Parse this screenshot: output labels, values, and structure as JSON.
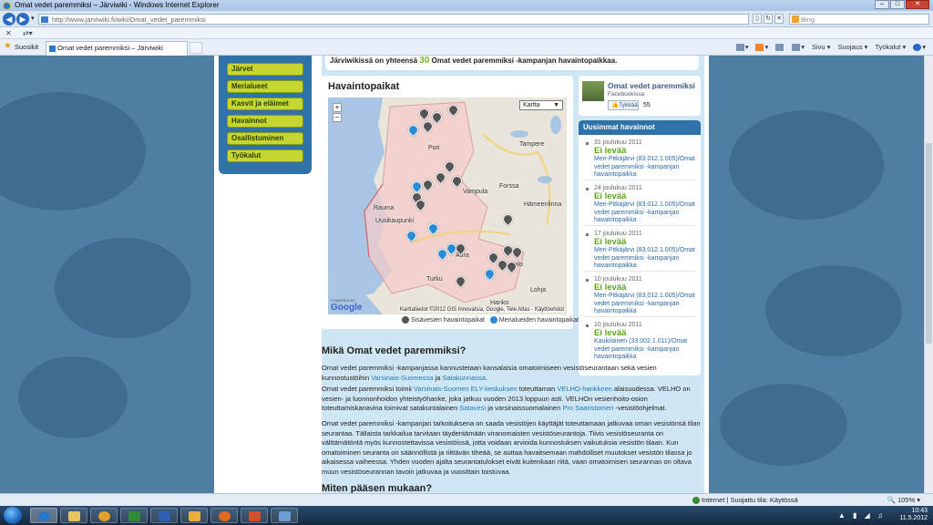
{
  "browser": {
    "title": "Omat vedet paremmiksi – Järviwiki - Windows Internet Explorer",
    "url": "http://www.jarviwiki.fi/wiki/Omat_vedet_paremmiksi",
    "search_placeholder": "Bing",
    "tab_label": "Omat vedet paremmiksi – Järviwiki",
    "favorites_label": "Suosikit",
    "cmd_page": "Sivu",
    "cmd_safety": "Suojaus",
    "cmd_tools": "Työkalut"
  },
  "sidebar": {
    "items": [
      "Järvet",
      "Merialueet",
      "Kasvit ja eläimet",
      "Havainnot",
      "Osallistuminen",
      "Työkalut"
    ]
  },
  "intro": {
    "prefix": "Järviwikissä on yhteensä",
    "count": "30",
    "suffix": "Omat vedet paremmiksi -kampanjan havaintopaikkaa."
  },
  "map": {
    "title": "Havaintopaikat",
    "type_select": "Kartta",
    "zoom_in": "+",
    "zoom_out": "−",
    "copyright": "Karttatiedot ©2012 GIS Innovatsia, Google, Tele Atlas - Käyttöehdot",
    "google": "Google",
    "powered": "POWERED BY",
    "places": [
      "Pori",
      "Tampere",
      "Rauma",
      "Vampula",
      "Uusikaupunki",
      "Hämeenlinna",
      "Aura",
      "Turku",
      "Salo",
      "Lohja",
      "Hanko",
      "Forssa"
    ],
    "legend_inland": "Sisävesien havaintopaikat",
    "legend_sea": "Merialueiden havaintopaikat",
    "inland_color": "#555555",
    "sea_color": "#2a8bd6"
  },
  "facebook": {
    "name": "Omat vedet paremmiksi",
    "sub": "Facebookissa",
    "like": "Tykkää",
    "count": "55"
  },
  "observations": {
    "heading": "Uusimmat havainnot",
    "items": [
      {
        "date": "31 joulukuu 2011",
        "value": "Ei levää",
        "site": "Meri-Pitkäjärvi (83.012.1.005)/Omat vedet paremmiksi -kampanjan havaintopaikka"
      },
      {
        "date": "24 joulukuu 2011",
        "value": "Ei levää",
        "site": "Meri-Pitkäjärvi (83.012.1.005)/Omat vedet paremmiksi -kampanjan havaintopaikka"
      },
      {
        "date": "17 joulukuu 2011",
        "value": "Ei levää",
        "site": "Meri-Pitkäjärvi (83.012.1.005)/Omat vedet paremmiksi -kampanjan havaintopaikka"
      },
      {
        "date": "10 joulukuu 2011",
        "value": "Ei levää",
        "site": "Meri-Pitkäjärvi (83.012.1.005)/Omat vedet paremmiksi -kampanjan havaintopaikka"
      },
      {
        "date": "10 joulukuu 2011",
        "value": "Ei levää",
        "site": "Kaukilainen (33.002.1.011)/Omat vedet paremmiksi -kampanjan havaintopaikka"
      }
    ]
  },
  "article": {
    "title": "Mikä Omat vedet paremmiksi?",
    "p1a": "Omat vedet paremmiksi -kampanjassa kannustetaan kansalaisia omatoimiseen vesistöseurantaan sekä vesien kunnostustöihin",
    "p1_link1": "Varsinais-Suomessa",
    "p1b": "ja",
    "p1_link2": "Satakunnassa",
    "p1c": ".",
    "p2a": "Omat vedet paremmiksi toimii",
    "p2_link1": "Varsinais-Suomen ELY-keskuksen",
    "p2b": "toteuttaman",
    "p2_link2": "VELHO-hankkeen",
    "p2c": "alaisuudessa. VELHO on vesien- ja luonnonhoidon yhteistyöhanke, joka jatkuu vuoden 2013 loppuun asti. VELHOn vesienhoito-osion toteuttamiskanavina toimivat satakuntalainen",
    "p2_link3": "Satavesi",
    "p2d": "ja varsinaissuomalainen",
    "p2_link4": "Pro Saaristomeri",
    "p2e": "-vesistöohjelmat.",
    "p3": "Omat vedet paremmiksi -kampanjan tarkoituksena on saada vesistöjen käyttäjät toteuttamaan jatkuvaa oman vesistönsä tilan seurantaa. Tällaista tarkkailua tarvitaan täydentämään viranomaisten vesistöseurantoja. Tiivis vesistöseuranta on välttämätöntä myös kunnostettavissa vesistöissä, jotta voidaan arvioida kunnostuksen vaikutuksia vesistön tilaan. Kun omatoiminen seuranta on säännöllistä ja riittävän tiheää, se auttaa havaitsemaan mahdolliset muutokset vesistön tilassa jo aikaisessa vaiheessa. Yhden vuoden ajalta seurantatulokset eivät kuitenkaan riitä, vaan omatoimisen seurannan on oltava muun vesistöseurannan tavoin jatkuvaa ja vuosittain toistuvaa.",
    "next_heading": "Miten pääsen mukaan?"
  },
  "status": {
    "zone": "Internet | Suojattu tila: Käytössä",
    "zoom": "105%"
  },
  "clock": {
    "time": "10:43",
    "date": "11.5.2012"
  }
}
